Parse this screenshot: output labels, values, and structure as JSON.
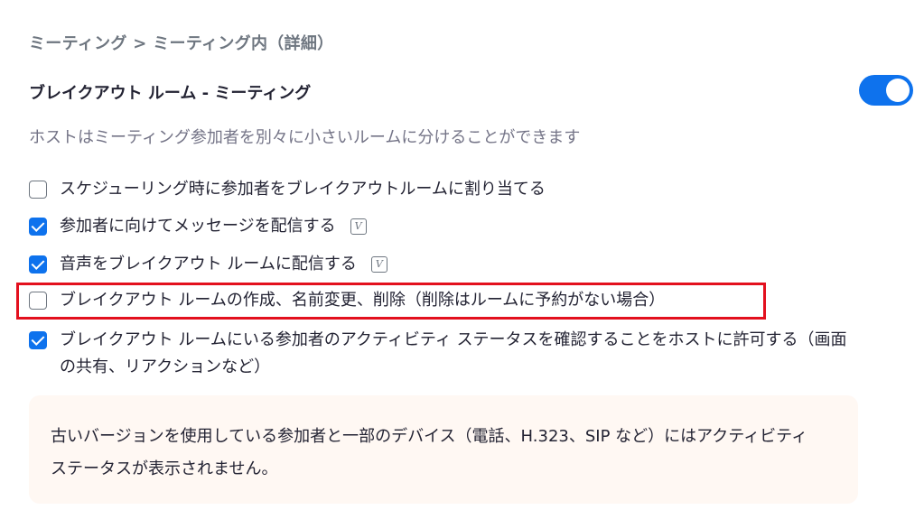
{
  "breadcrumb": "ミーティング > ミーティング内（詳細）",
  "section": {
    "title": "ブレイクアウト ルーム - ミーティング",
    "toggle_on": true,
    "description": "ホストはミーティング参加者を別々に小さいルームに分けることができます"
  },
  "options": [
    {
      "label": "スケジューリング時に参加者をブレイクアウトルームに割り当てる",
      "checked": false
    },
    {
      "label": "参加者に向けてメッセージを配信する",
      "checked": true,
      "badge": "V"
    },
    {
      "label": "音声をブレイクアウト ルームに配信する",
      "checked": true,
      "badge": "V"
    },
    {
      "label": "ブレイクアウト ルームの作成、名前変更、削除（削除はルームに予約がない場合）",
      "checked": false
    },
    {
      "label": "ブレイクアウト ルームにいる参加者のアクティビティ ステータスを確認することをホストに許可する（画面の共有、リアクションなど）",
      "checked": true
    }
  ],
  "notice": "古いバージョンを使用している参加者と一部のデバイス（電話、H.323、SIP など）にはアクティビティ ステータスが表示されません。",
  "colors": {
    "accent": "#0e72ed",
    "highlight": "#e3101e",
    "notice_bg": "#fff8f3"
  }
}
